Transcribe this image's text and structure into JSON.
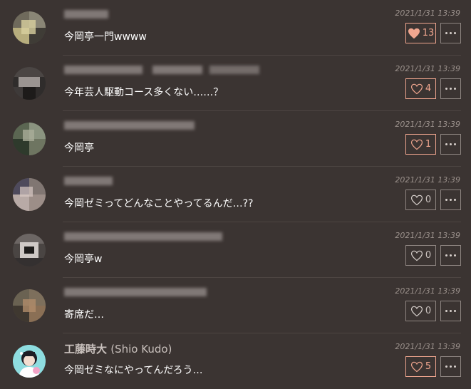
{
  "accent_color": "#f0a68f",
  "comments": [
    {
      "author": "",
      "text": "今岡亭一門wwww",
      "timestamp": "2021/1/31 13:39",
      "likes": "13",
      "liked": true,
      "heart_icon": "heart-filled-icon",
      "more_icon": "more-options-icon"
    },
    {
      "author": "",
      "text": "今年芸人駆動コース多くない……？",
      "timestamp": "2021/1/31 13:39",
      "likes": "4",
      "liked": true,
      "heart_icon": "heart-outline-icon",
      "more_icon": "more-options-icon"
    },
    {
      "author": "",
      "text": "今岡亭",
      "timestamp": "2021/1/31 13:39",
      "likes": "1",
      "liked": true,
      "heart_icon": "heart-outline-icon",
      "more_icon": "more-options-icon"
    },
    {
      "author": "",
      "text": "今岡ゼミってどんなことやってるんだ…??",
      "timestamp": "2021/1/31 13:39",
      "likes": "0",
      "liked": false,
      "heart_icon": "heart-outline-icon",
      "more_icon": "more-options-icon"
    },
    {
      "author": "",
      "text": "今岡亭w",
      "timestamp": "2021/1/31 13:39",
      "likes": "0",
      "liked": false,
      "heart_icon": "heart-outline-icon",
      "more_icon": "more-options-icon"
    },
    {
      "author": "",
      "text": "寄席だ…",
      "timestamp": "2021/1/31 13:39",
      "likes": "0",
      "liked": false,
      "heart_icon": "heart-outline-icon",
      "more_icon": "more-options-icon"
    },
    {
      "author": "工藤時大",
      "author_suffix": "(Shio Kudo)",
      "text": "今岡ゼミなにやってんだろう…",
      "timestamp": "2021/1/31 13:39",
      "likes": "5",
      "liked": true,
      "heart_icon": "heart-outline-icon",
      "more_icon": "more-options-icon"
    }
  ]
}
